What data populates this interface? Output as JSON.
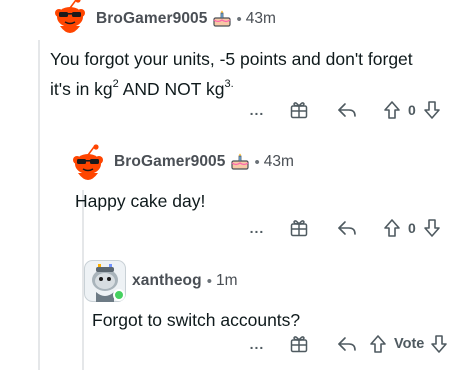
{
  "colors": {
    "accent_orange": "#ff4500",
    "meta_text": "#4a4f55",
    "thread_line": "#e5e7e9",
    "online_green": "#46d160"
  },
  "comments": [
    {
      "username": "BroGamer9005",
      "separator": "•",
      "time": "43m",
      "text_parts": [
        "You forgot your units, -5 points and don't forget",
        "it's in kg",
        "2",
        " AND NOT kg",
        "3."
      ],
      "vote_label": "0",
      "avatar_icon": "snoo-sunglasses-avatar-icon",
      "flair_icon": "cake-day-icon"
    },
    {
      "username": "BroGamer9005",
      "separator": "•",
      "time": "43m",
      "text": "Happy cake day!",
      "vote_label": "0",
      "avatar_icon": "snoo-sunglasses-avatar-icon",
      "flair_icon": "cake-day-icon"
    },
    {
      "username": "xantheog",
      "separator": "•",
      "time": "1m",
      "text": "Forgot to switch accounts?",
      "vote_label": "Vote",
      "avatar_icon": "custom-snoo-avatar-icon"
    }
  ],
  "actions": {
    "more_label": "...",
    "icons": [
      "more-options-icon",
      "award-icon",
      "reply-icon",
      "upvote-icon",
      "downvote-icon"
    ]
  }
}
